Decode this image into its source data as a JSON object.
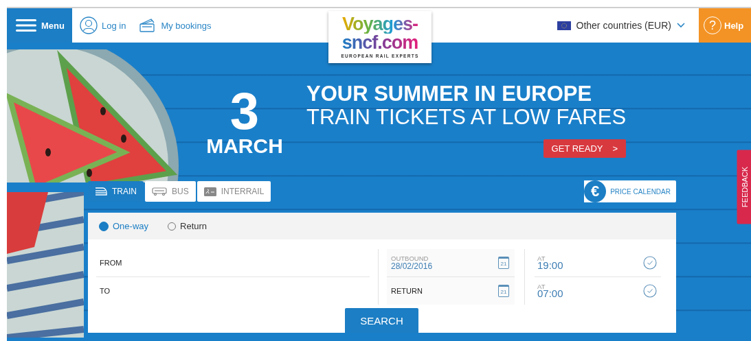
{
  "header": {
    "menu_button": "Menu",
    "login": "Log in",
    "bookings": "My bookings",
    "logo": {
      "line1": "Voyages-",
      "line2": "sncf.com",
      "tagline": "EUROPEAN RAIL EXPERTS"
    },
    "country": "Other countries (EUR)",
    "help_symbol": "?",
    "help": "Help"
  },
  "promo": {
    "day": "3",
    "month": "MARCH",
    "headline": "YOUR SUMMER IN EUROPE",
    "subheadline": "TRAIN TICKETS AT LOW FARES",
    "cta": "GET READY",
    "cta_arrow": ">"
  },
  "tabs": [
    {
      "kind": "train",
      "label": "TRAIN",
      "selected": true
    },
    {
      "kind": "bus",
      "label": "BUS",
      "selected": false
    },
    {
      "kind": "interrail",
      "label": "INTERRAIL",
      "selected": false
    }
  ],
  "price_calendar": {
    "symbol": "€",
    "label": "PRICE CALENDAR"
  },
  "trip_types": [
    {
      "label": "One-way",
      "selected": true
    },
    {
      "label": "Return",
      "selected": false
    }
  ],
  "places": [
    {
      "placeholder": "FROM"
    },
    {
      "placeholder": "TO"
    }
  ],
  "dates": [
    {
      "label": "OUTBOUND",
      "value": "28/02/2016",
      "calendar_day": "21"
    },
    {
      "placeholder": "RETURN",
      "calendar_day": "21"
    }
  ],
  "times": [
    {
      "label": "AT",
      "value": "19:00"
    },
    {
      "label": "AT",
      "value": "07:00"
    }
  ],
  "search_button": "SEARCH",
  "feedback": "FEEDBACK"
}
